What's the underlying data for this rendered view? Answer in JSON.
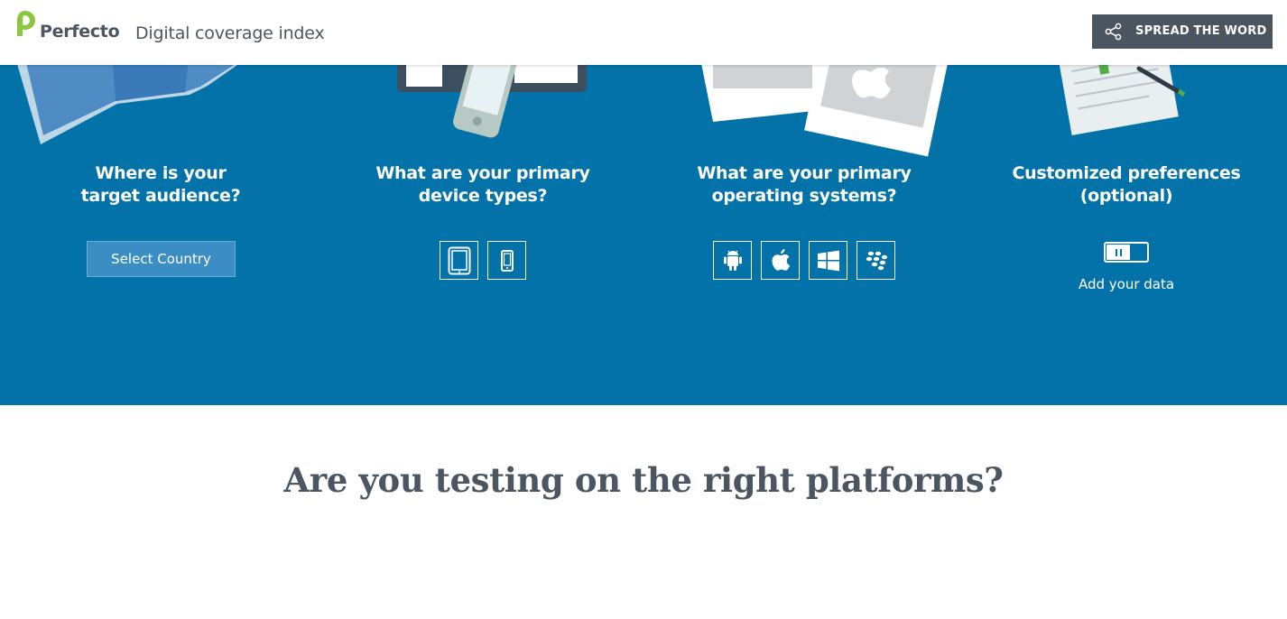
{
  "header": {
    "logo_text": "Perfecto",
    "app_title": "Digital coverage index",
    "spread_button": "SPREAD THE WORD",
    "share_icon": "share-icon"
  },
  "hero": {
    "background": "#0272a8",
    "audience": {
      "heading_line1": "Where is your",
      "heading_line2": "target audience?",
      "select_label": "Select Country"
    },
    "devices": {
      "heading_line1": "What are your primary",
      "heading_line2": "device types?",
      "options": [
        "tablet-icon",
        "phone-icon"
      ]
    },
    "os": {
      "heading_line1": "What are your primary",
      "heading_line2": "operating systems?",
      "options": [
        "android-icon",
        "apple-icon",
        "windows-icon",
        "blackberry-icon"
      ]
    },
    "prefs": {
      "heading_line1": "Customized preferences",
      "heading_line2": "(optional)",
      "add_data_label": "Add your data"
    }
  },
  "main": {
    "tagline": "Are you testing on the right platforms?"
  },
  "colors": {
    "accent": "#0272a8",
    "dark": "#4a5560",
    "logo_green": "#8cc63f"
  }
}
